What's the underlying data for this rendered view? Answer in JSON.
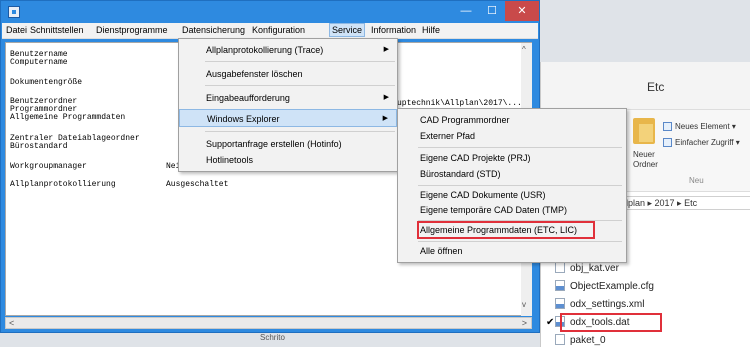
{
  "window": {
    "min": "—",
    "max": "☐",
    "close": "✕"
  },
  "menubar": [
    "Datei",
    "Schnittstellen",
    "Dienstprogramme",
    "Datensicherung",
    "Konfiguration",
    "Service",
    "Information",
    "Hilfe"
  ],
  "labels": [
    "Benutzername",
    "Computername",
    "Dokumentengröße",
    "Benutzerordner",
    "Programmordner",
    "Allgemeine Programmdaten",
    "Zentraler Dateiablageordner",
    "Bürostandard",
    "Workgroupmanager",
    "Allplanprotokollierung"
  ],
  "values": {
    "workgroupmanager": "Nein",
    "allplanprotokollierung": "Ausgeschaltet"
  },
  "partial_text": "uptechnik\\Allplan\\2017\\...",
  "service_menu": {
    "items": [
      {
        "label": "Allplanprotokollierung (Trace)",
        "submenu": "▶"
      },
      {
        "label": "Ausgabefenster löschen"
      },
      {
        "label": "Eingabeaufforderung",
        "submenu": "▶"
      },
      {
        "label": "Windows Explorer",
        "submenu": "▶"
      },
      {
        "label": "Supportanfrage erstellen (Hotinfo)"
      },
      {
        "label": "Hotlinetools"
      }
    ]
  },
  "explorer_submenu": {
    "items": [
      "CAD Programmordner",
      "Externer Pfad",
      "Eigene CAD Projekte (PRJ)",
      "Bürostandard (STD)",
      "Eigene CAD Dokumente (USR)",
      "Eigene temporäre CAD Daten (TMP)",
      "Allgemeine Programmdaten (ETC, LIC)",
      "Alle öffnen"
    ]
  },
  "explorer": {
    "title": "Etc",
    "ribbon": {
      "new_item": "Neues Element ▾",
      "easy_access": "Einfacher Zugriff ▾",
      "new_folder_1": "Neuer",
      "new_folder_2": "Ordner",
      "group_new": "Neu"
    },
    "address": "llplan ▸ 2017 ▸ Etc",
    "files": [
      "obj_kat.ver",
      "ObjectExample.cfg",
      "odx_settings.xml",
      "odx_tools.dat",
      "paket_0"
    ],
    "check_mark": "✔"
  },
  "bottom_partial": "Schrito",
  "scroll": {
    "left": "<",
    "right": ">",
    "up": "^",
    "down": "v"
  }
}
